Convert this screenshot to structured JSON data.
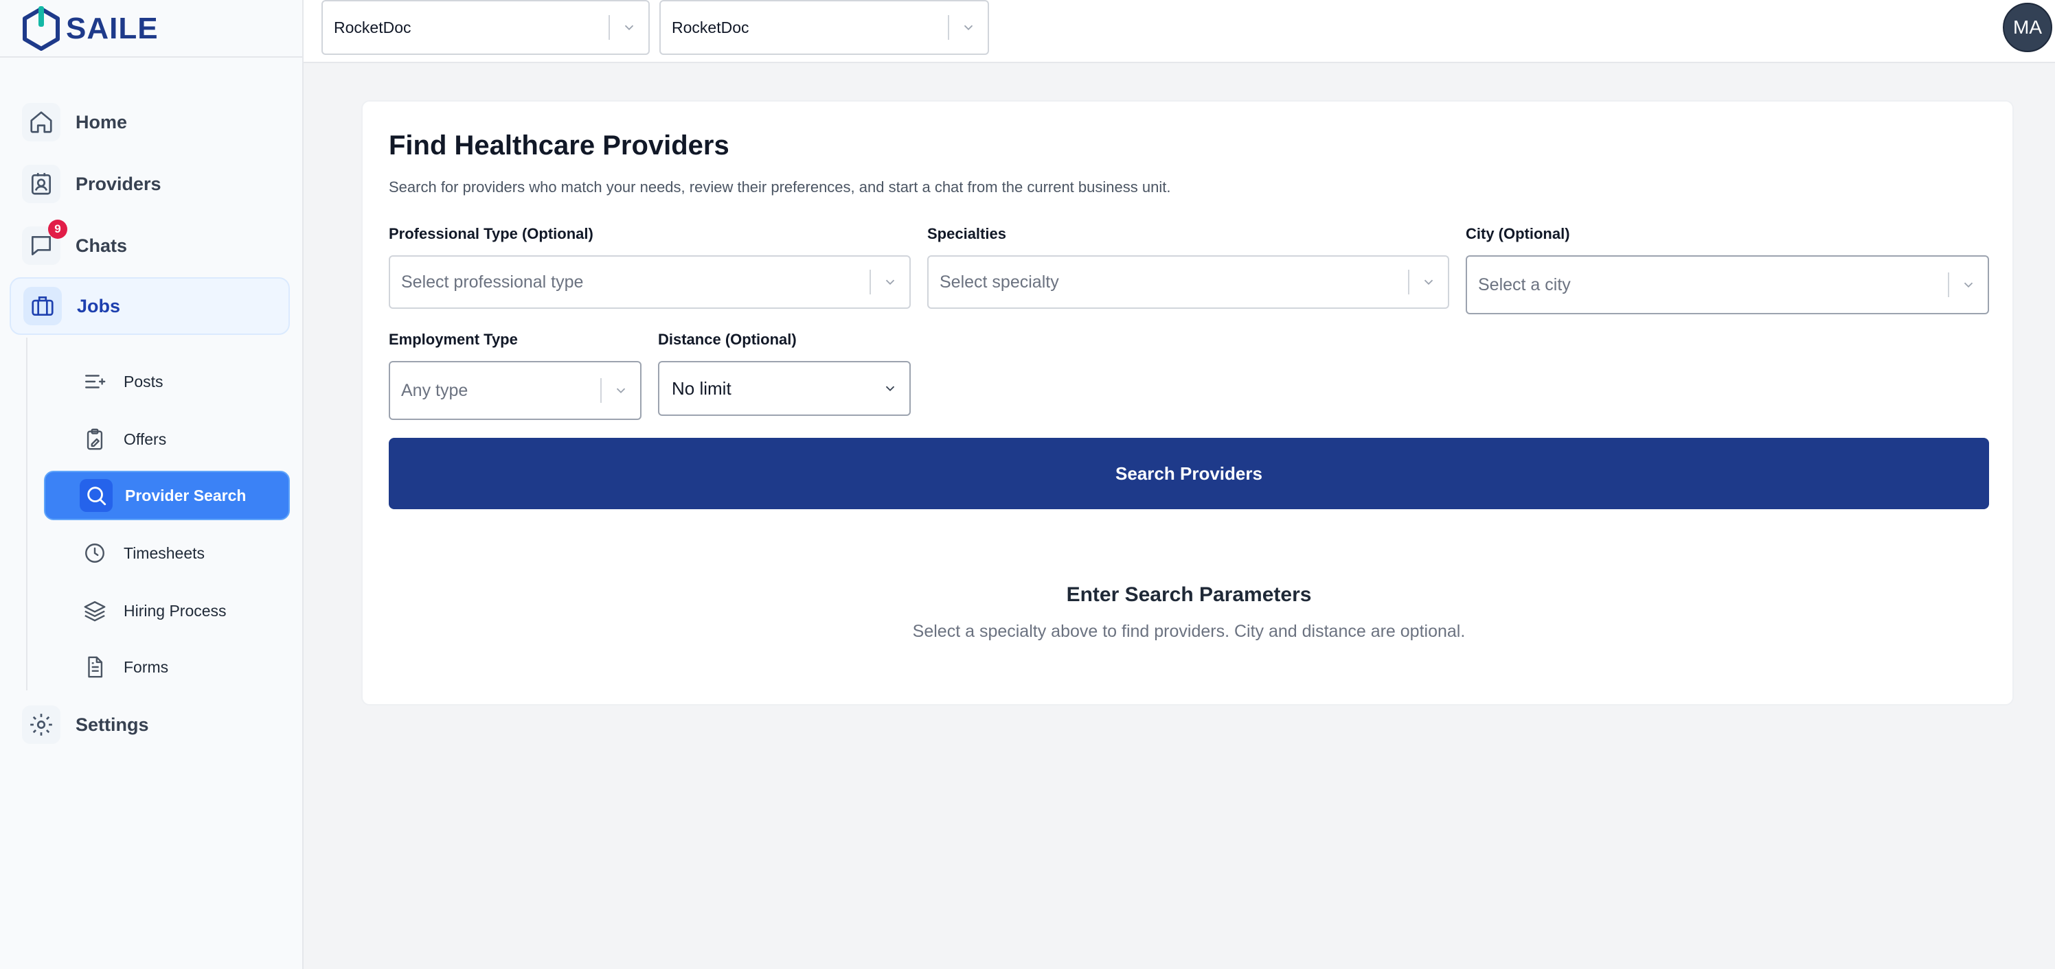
{
  "brand": {
    "name": "SAILE",
    "accent": "#1e3a8a"
  },
  "sidebar": {
    "nav": [
      {
        "label": "Home",
        "icon": "home-icon"
      },
      {
        "label": "Providers",
        "icon": "provider-badge-icon"
      },
      {
        "label": "Chats",
        "icon": "chat-icon",
        "badge": "9"
      },
      {
        "label": "Jobs",
        "icon": "briefcase-icon",
        "active": true
      }
    ],
    "jobs_sub": [
      {
        "label": "Posts",
        "icon": "list-add-icon"
      },
      {
        "label": "Offers",
        "icon": "clipboard-icon"
      },
      {
        "label": "Provider Search",
        "icon": "search-icon",
        "active": true
      },
      {
        "label": "Timesheets",
        "icon": "clock-icon"
      },
      {
        "label": "Hiring Process",
        "icon": "layers-icon"
      },
      {
        "label": "Forms",
        "icon": "document-icon"
      }
    ],
    "settings": {
      "label": "Settings",
      "icon": "gear-icon"
    }
  },
  "topbar": {
    "org_select": "RocketDoc",
    "unit_select": "RocketDoc",
    "avatar_initials": "MA"
  },
  "main": {
    "title": "Find Healthcare Providers",
    "subtitle": "Search for providers who match your needs, review their preferences, and start a chat from the current business unit.",
    "fields": {
      "professional_type": {
        "label": "Professional Type (Optional)",
        "placeholder": "Select professional type"
      },
      "specialties": {
        "label": "Specialties",
        "placeholder": "Select specialty"
      },
      "city": {
        "label": "City (Optional)",
        "placeholder": "Select a city"
      },
      "employment_type": {
        "label": "Employment Type",
        "placeholder": "Any type"
      },
      "distance": {
        "label": "Distance (Optional)",
        "value": "No limit"
      }
    },
    "search_button": "Search Providers",
    "empty_state": {
      "title": "Enter Search Parameters",
      "message": "Select a specialty above to find providers. City and distance are optional."
    }
  }
}
